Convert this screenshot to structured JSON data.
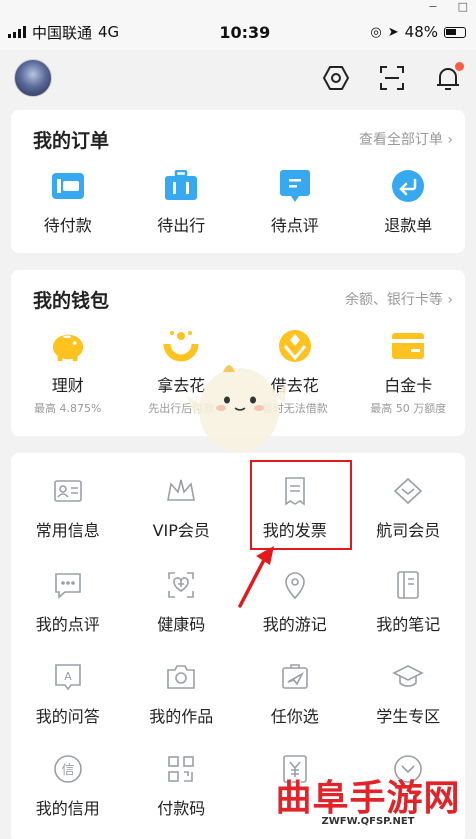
{
  "status": {
    "carrier": "中国联通",
    "network": "4G",
    "time": "10:39",
    "battery": "48%"
  },
  "window_controls": {
    "minimize": "−",
    "maximize": "□"
  },
  "topbar": {
    "icons": [
      "settings-hexagon-icon",
      "scan-icon",
      "bell-icon"
    ]
  },
  "orders": {
    "title": "我的订单",
    "link": "查看全部订单 ›",
    "items": [
      {
        "label": "待付款",
        "icon": "wallet-icon"
      },
      {
        "label": "待出行",
        "icon": "suitcase-icon"
      },
      {
        "label": "待点评",
        "icon": "comment-icon"
      },
      {
        "label": "退款单",
        "icon": "refund-icon"
      }
    ]
  },
  "wallet": {
    "title": "我的钱包",
    "link": "余额、银行卡等 ›",
    "items": [
      {
        "label": "理财",
        "sub": "最高 4.875%",
        "icon": "piggy-bank-icon"
      },
      {
        "label": "拿去花",
        "sub": "先出行后付款",
        "icon": "spend-icon"
      },
      {
        "label": "借去花",
        "sub": "暂时无法借款",
        "icon": "borrow-icon"
      },
      {
        "label": "白金卡",
        "sub": "最高 50 万额度",
        "icon": "card-icon"
      }
    ]
  },
  "services": {
    "rows": [
      [
        {
          "label": "常用信息",
          "icon": "id-card-icon"
        },
        {
          "label": "VIP会员",
          "icon": "crown-icon"
        },
        {
          "label": "我的发票",
          "icon": "invoice-icon"
        },
        {
          "label": "航司会员",
          "icon": "airline-icon"
        }
      ],
      [
        {
          "label": "我的点评",
          "icon": "review-icon"
        },
        {
          "label": "健康码",
          "icon": "health-code-icon"
        },
        {
          "label": "我的游记",
          "icon": "location-icon"
        },
        {
          "label": "我的笔记",
          "icon": "notebook-icon"
        }
      ],
      [
        {
          "label": "我的问答",
          "icon": "qa-icon"
        },
        {
          "label": "我的作品",
          "icon": "camera-icon"
        },
        {
          "label": "任你选",
          "icon": "ticket-icon"
        },
        {
          "label": "学生专区",
          "icon": "graduation-cap-icon"
        }
      ],
      [
        {
          "label": "我的信用",
          "icon": "credit-icon"
        },
        {
          "label": "付款码",
          "icon": "qr-code-icon"
        },
        {
          "label": "",
          "icon": "yuan-icon"
        },
        {
          "label": "",
          "icon": "more-icon"
        }
      ]
    ]
  },
  "watermark": {
    "title": "曲阜手游网",
    "url": "ZWFW.QFSP.NET"
  },
  "colors": {
    "accent_blue": "#36a9f0",
    "accent_yellow": "#ffc21f",
    "highlight_red": "#e3191b",
    "icon_grey": "#9aa0a6"
  }
}
